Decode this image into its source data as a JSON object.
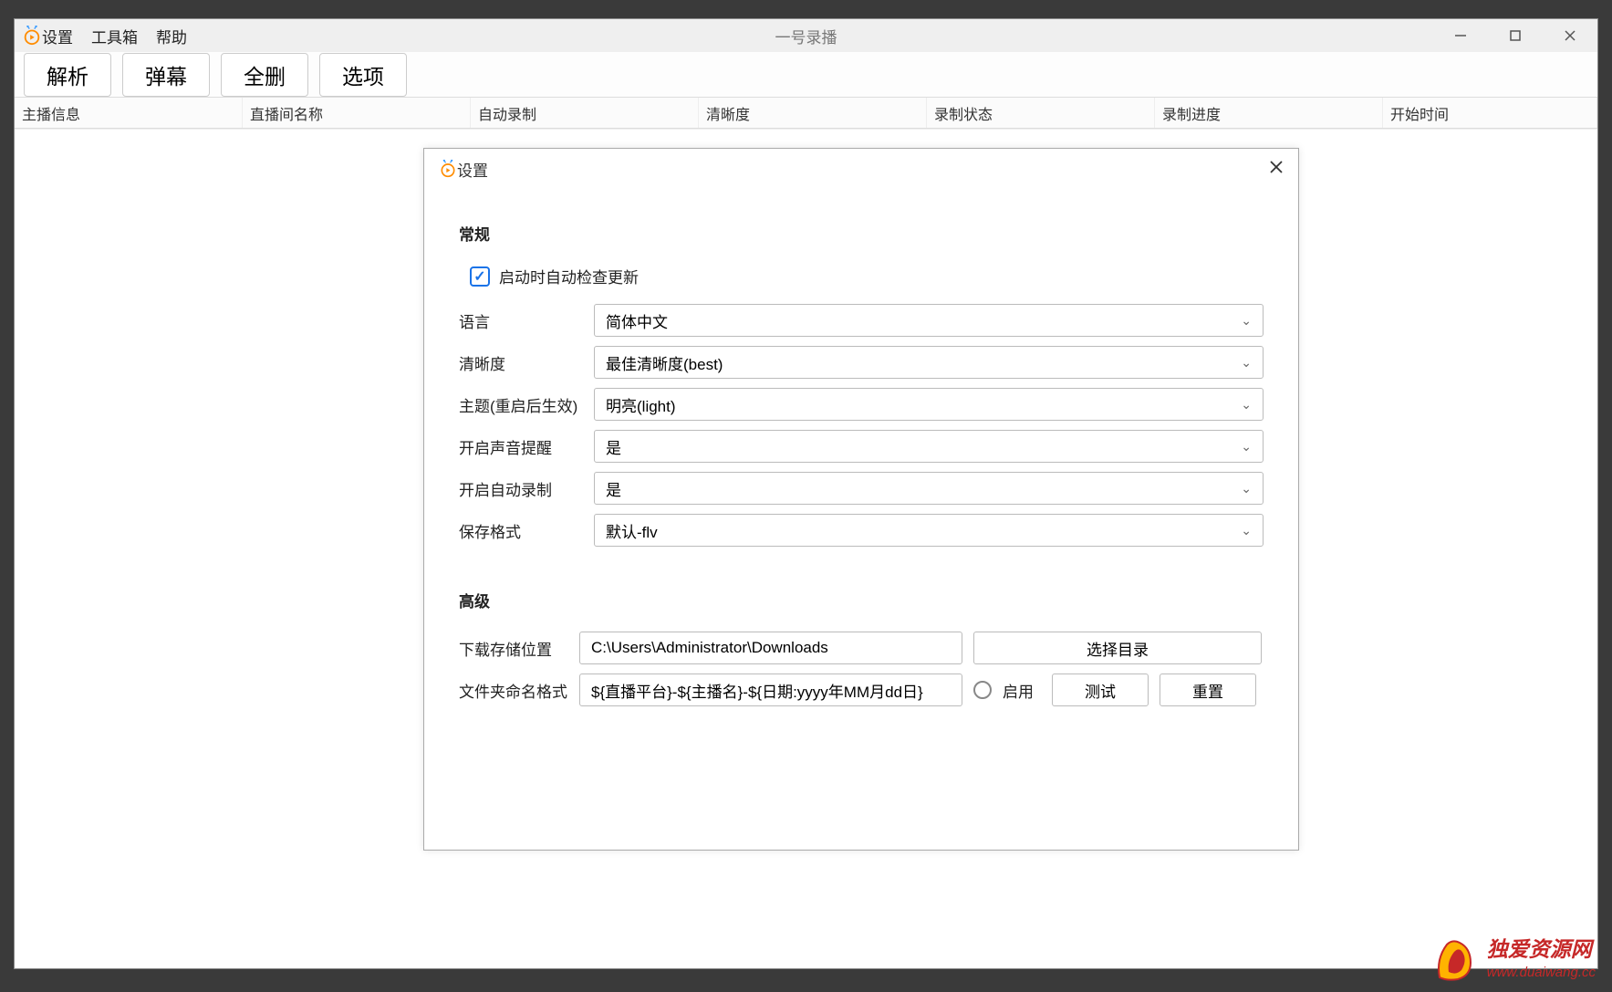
{
  "window": {
    "title": "一号录播",
    "menus": [
      "设置",
      "工具箱",
      "帮助"
    ]
  },
  "toolbar": {
    "buttons": [
      "解析",
      "弹幕",
      "全删",
      "选项"
    ]
  },
  "table": {
    "headers": [
      "主播信息",
      "直播间名称",
      "自动录制",
      "清晰度",
      "录制状态",
      "录制进度",
      "开始时间"
    ]
  },
  "dialog": {
    "title": "设置",
    "section_general": "常规",
    "check_update_label": "启动时自动检查更新",
    "rows": {
      "language": {
        "label": "语言",
        "value": "简体中文"
      },
      "quality": {
        "label": "清晰度",
        "value": "最佳清晰度(best)"
      },
      "theme": {
        "label": "主题(重启后生效)",
        "value": "明亮(light)"
      },
      "sound": {
        "label": "开启声音提醒",
        "value": "是"
      },
      "auto_rec": {
        "label": "开启自动录制",
        "value": "是"
      },
      "format": {
        "label": "保存格式",
        "value": "默认-flv"
      }
    },
    "section_advanced": "高级",
    "download_path": {
      "label": "下载存储位置",
      "value": "C:\\Users\\Administrator\\Downloads",
      "choose": "选择目录"
    },
    "folder_format": {
      "label": "文件夹命名格式",
      "value": "${直播平台}-${主播名}-${日期:yyyy年MM月dd日}",
      "enable": "启用",
      "test": "测试",
      "reset": "重置"
    }
  },
  "watermark": {
    "title": "独爱资源网",
    "url": "www.duaiwang.cc"
  }
}
